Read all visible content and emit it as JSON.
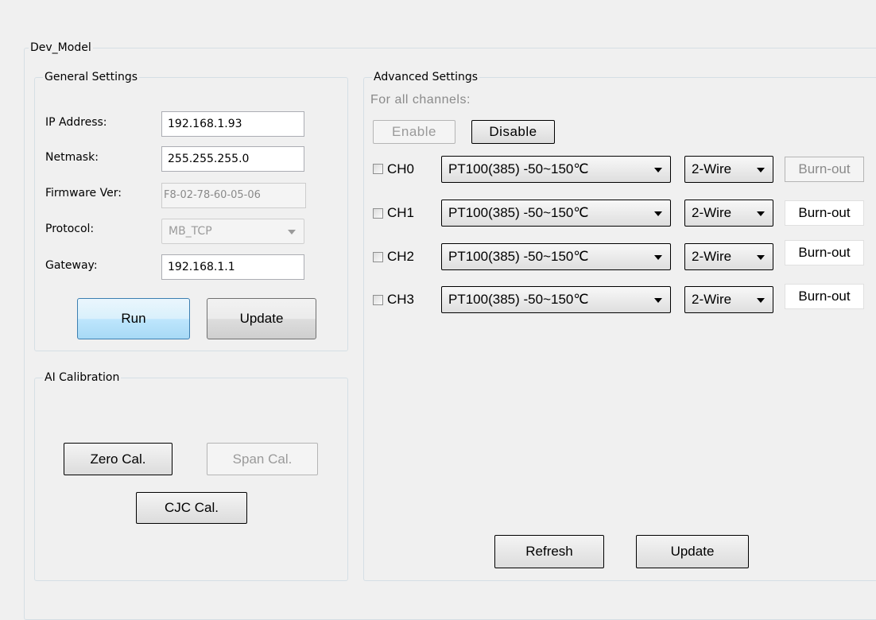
{
  "dev_group": {
    "title": "Dev_Model"
  },
  "general": {
    "title": "General Settings",
    "ip_label": "IP Address:",
    "ip_value": "192.168.1.93",
    "netmask_label": "Netmask:",
    "netmask_value": "255.255.255.0",
    "firmware_label": "Firmware Ver:",
    "firmware_value": "F8-02-78-60-05-06",
    "protocol_label": "Protocol:",
    "protocol_value": "MB_TCP",
    "gateway_label": "Gateway:",
    "gateway_value": "192.168.1.1",
    "run_label": "Run",
    "update_label": "Update"
  },
  "calibration": {
    "title": "AI Calibration",
    "zero_label": "Zero Cal.",
    "span_label": "Span Cal.",
    "cjc_label": "CJC Cal."
  },
  "advanced": {
    "title": "Advanced Settings",
    "all_channels_label": "For all channels:",
    "enable_label": "Enable",
    "disable_label": "Disable",
    "channels": [
      {
        "name": "CH0",
        "range": "PT100(385) -50~150℃",
        "wire": "2-Wire",
        "burnout": "Burn-out"
      },
      {
        "name": "CH1",
        "range": "PT100(385) -50~150℃",
        "wire": "2-Wire",
        "burnout": "Burn-out"
      },
      {
        "name": "CH2",
        "range": "PT100(385) -50~150℃",
        "wire": "2-Wire",
        "burnout": "Burn-out"
      },
      {
        "name": "CH3",
        "range": "PT100(385) -50~150℃",
        "wire": "2-Wire",
        "burnout": "Burn-out"
      }
    ],
    "refresh_label": "Refresh",
    "update_label": "Update"
  }
}
